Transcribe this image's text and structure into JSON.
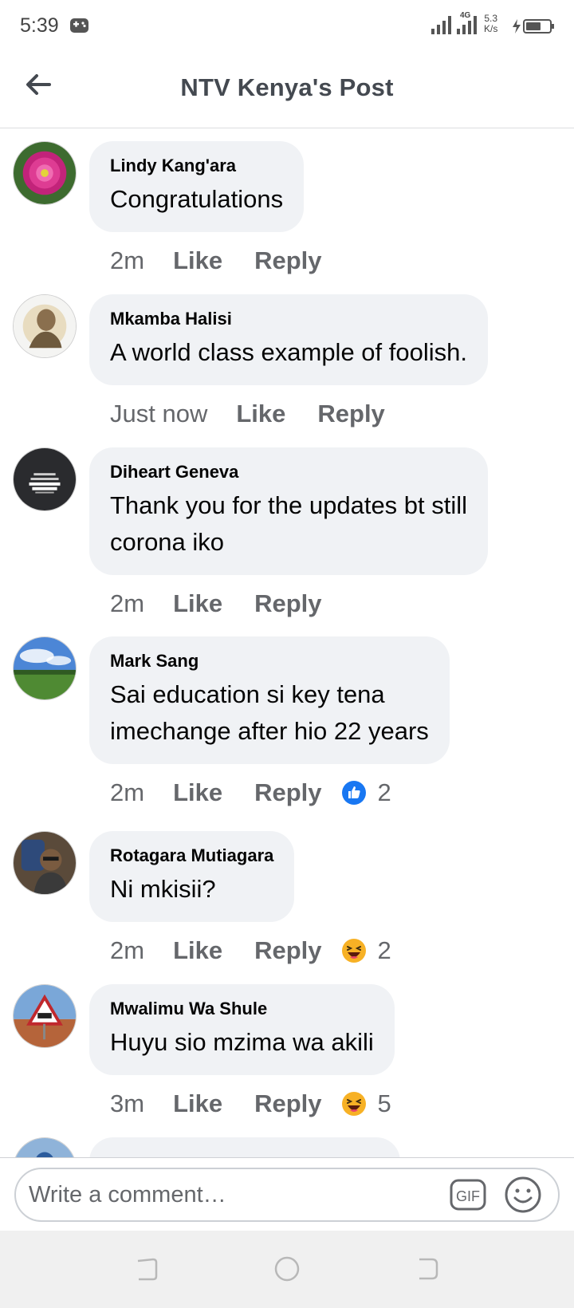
{
  "status_bar": {
    "time": "5:39",
    "network_type": "4G",
    "speed_value": "5.3",
    "speed_unit": "K/s",
    "icons": [
      "game-controller-icon",
      "signal-icon",
      "signal-icon",
      "battery-charging-icon"
    ]
  },
  "header": {
    "title": "NTV Kenya's Post",
    "back_icon": "arrow-left-icon"
  },
  "comments": [
    {
      "author": "Lindy Kang'ara",
      "lines": [
        "Congratulations"
      ],
      "time": "2m",
      "like": "Like",
      "reply": "Reply",
      "reaction": null
    },
    {
      "author": "Mkamba Halisi",
      "lines": [
        "A world class example of foolish."
      ],
      "time": "Just now",
      "like": "Like",
      "reply": "Reply",
      "reaction": null
    },
    {
      "author": "Diheart Geneva",
      "lines": [
        "Thank you for the updates bt still",
        "corona iko"
      ],
      "time": "2m",
      "like": "Like",
      "reply": "Reply",
      "reaction": null
    },
    {
      "author": "Mark Sang",
      "lines": [
        "Sai education  si key tena",
        "imechange after  hio 22 years"
      ],
      "time": "2m",
      "like": "Like",
      "reply": "Reply",
      "reaction": {
        "type": "like-reaction-icon",
        "count": "2"
      }
    },
    {
      "author": "Rotagara Mutiagara",
      "lines": [
        "Ni mkisii?"
      ],
      "time": "2m",
      "like": "Like",
      "reply": "Reply",
      "reaction": {
        "type": "haha-reaction-icon",
        "count": "2"
      }
    },
    {
      "author": "Mwalimu Wa Shule",
      "lines": [
        "Huyu sio mzima wa akili"
      ],
      "time": "3m",
      "like": "Like",
      "reply": "Reply",
      "reaction": {
        "type": "haha-reaction-icon",
        "count": "5"
      }
    }
  ],
  "composer": {
    "placeholder": "Write a comment…",
    "gif_label": "GIF",
    "icons": [
      "gif-icon",
      "emoji-icon"
    ]
  },
  "nav_bar": {
    "icons": [
      "recent-apps-icon",
      "home-icon",
      "back-icon"
    ]
  },
  "colors": {
    "bubble": "#f0f2f5",
    "secondary_text": "#65676b",
    "like_blue": "#1877f2",
    "haha_yellow": "#f7b125"
  }
}
